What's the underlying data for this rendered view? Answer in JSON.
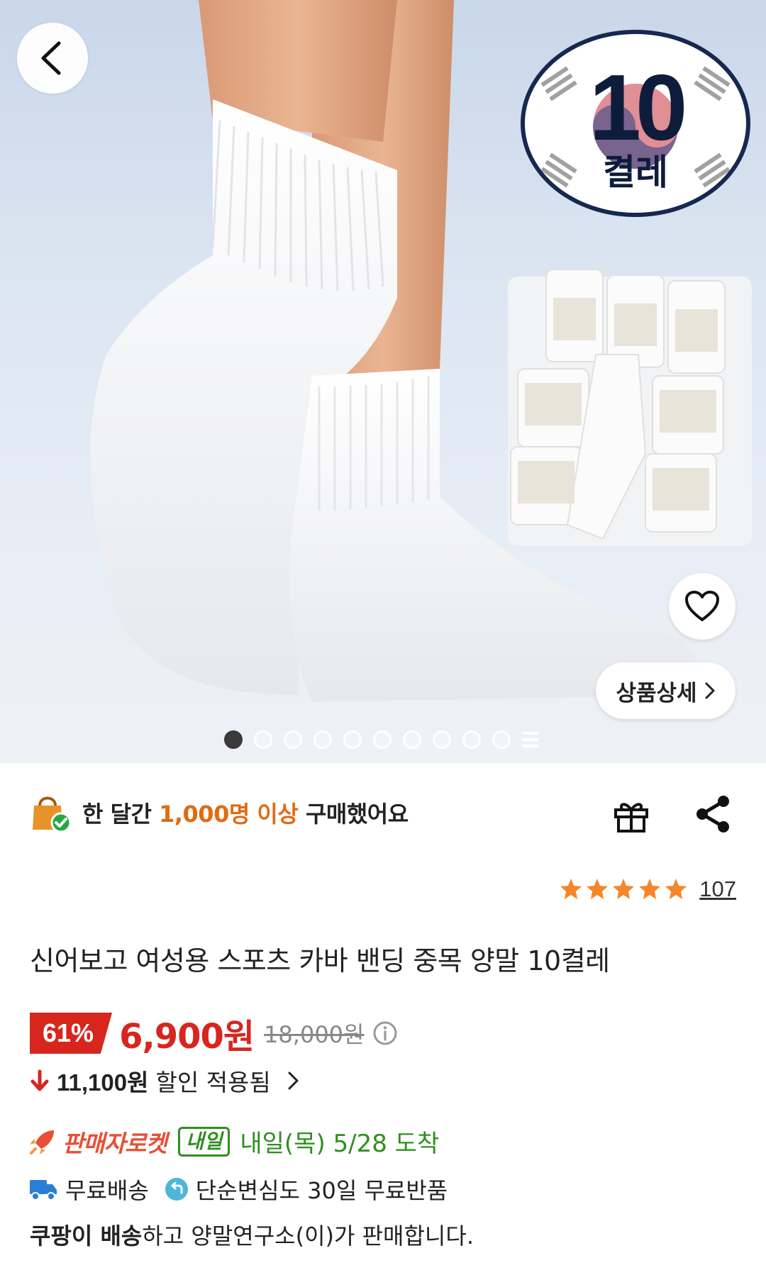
{
  "hero": {
    "badge_number": "10",
    "badge_word": "켤레",
    "detail_button_label": "상품상세",
    "carousel": {
      "total": 10,
      "active": 1
    }
  },
  "purchase_note": {
    "prefix": "한 달간",
    "highlight": "1,000명 이상",
    "suffix": "구매했어요"
  },
  "rating": {
    "stars": 5,
    "review_count": "107"
  },
  "product": {
    "title": "신어보고 여성용 스포츠 카바 밴딩 중목 양말 10켤레"
  },
  "price": {
    "discount_rate": "61%",
    "sale_price": "6,900원",
    "original_price": "18,000원",
    "saving_amount": "11,100원",
    "saving_label": "할인 적용됨"
  },
  "delivery": {
    "brand": "판매자로켓",
    "tag": "내일",
    "eta": "내일(목) 5/28 도착",
    "free_shipping": "무료배송",
    "free_return": "단순변심도 30일 무료반품"
  },
  "seller": {
    "courier": "쿠팡이 배송",
    "rest": "하고 양말연구소(이)가 판매합니다."
  },
  "colors": {
    "accent_red": "#d7261e",
    "rocket_red": "#e84f35",
    "green": "#2f8f1f",
    "orange": "#e06a12",
    "star": "#f5862a"
  }
}
